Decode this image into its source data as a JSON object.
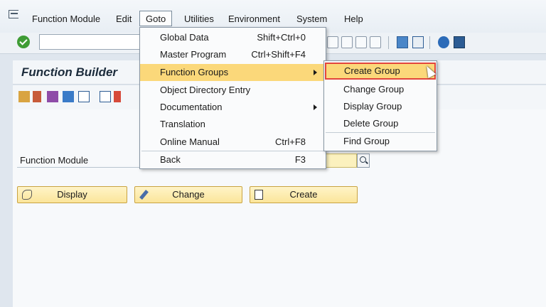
{
  "menubar": {
    "items": [
      {
        "label": "Function Module"
      },
      {
        "label": "Edit"
      },
      {
        "label": "Goto"
      },
      {
        "label": "Utilities"
      },
      {
        "label": "Environment"
      },
      {
        "label": "System"
      },
      {
        "label": "Help"
      }
    ],
    "active": "Goto"
  },
  "title": "Function Builder",
  "goto_menu": {
    "items": [
      {
        "label": "Global Data",
        "shortcut": "Shift+Ctrl+0"
      },
      {
        "label": "Master Program",
        "shortcut": "Ctrl+Shift+F4"
      },
      {
        "label": "Function Groups",
        "submenu": true
      },
      {
        "label": "Object Directory Entry"
      },
      {
        "label": "Documentation",
        "submenu": true
      },
      {
        "label": "Translation"
      },
      {
        "label": "Online Manual",
        "shortcut": "Ctrl+F8"
      },
      {
        "label": "Back",
        "shortcut": "F3"
      }
    ],
    "highlighted": "Function Groups"
  },
  "function_groups_submenu": {
    "items": [
      {
        "label": "Create Group"
      },
      {
        "label": "Change Group"
      },
      {
        "label": "Display Group"
      },
      {
        "label": "Delete Group"
      },
      {
        "label": "Find Group"
      }
    ],
    "selected": "Create Group"
  },
  "form": {
    "function_module_label": "Function Module",
    "function_module_value": ""
  },
  "buttons": {
    "display": "Display",
    "change": "Change",
    "create": "Create"
  },
  "colors": {
    "highlight": "#fbd87a",
    "selection_border": "#e2453c",
    "input_required": "#fbf1be",
    "ok_green": "#3f9c35"
  }
}
